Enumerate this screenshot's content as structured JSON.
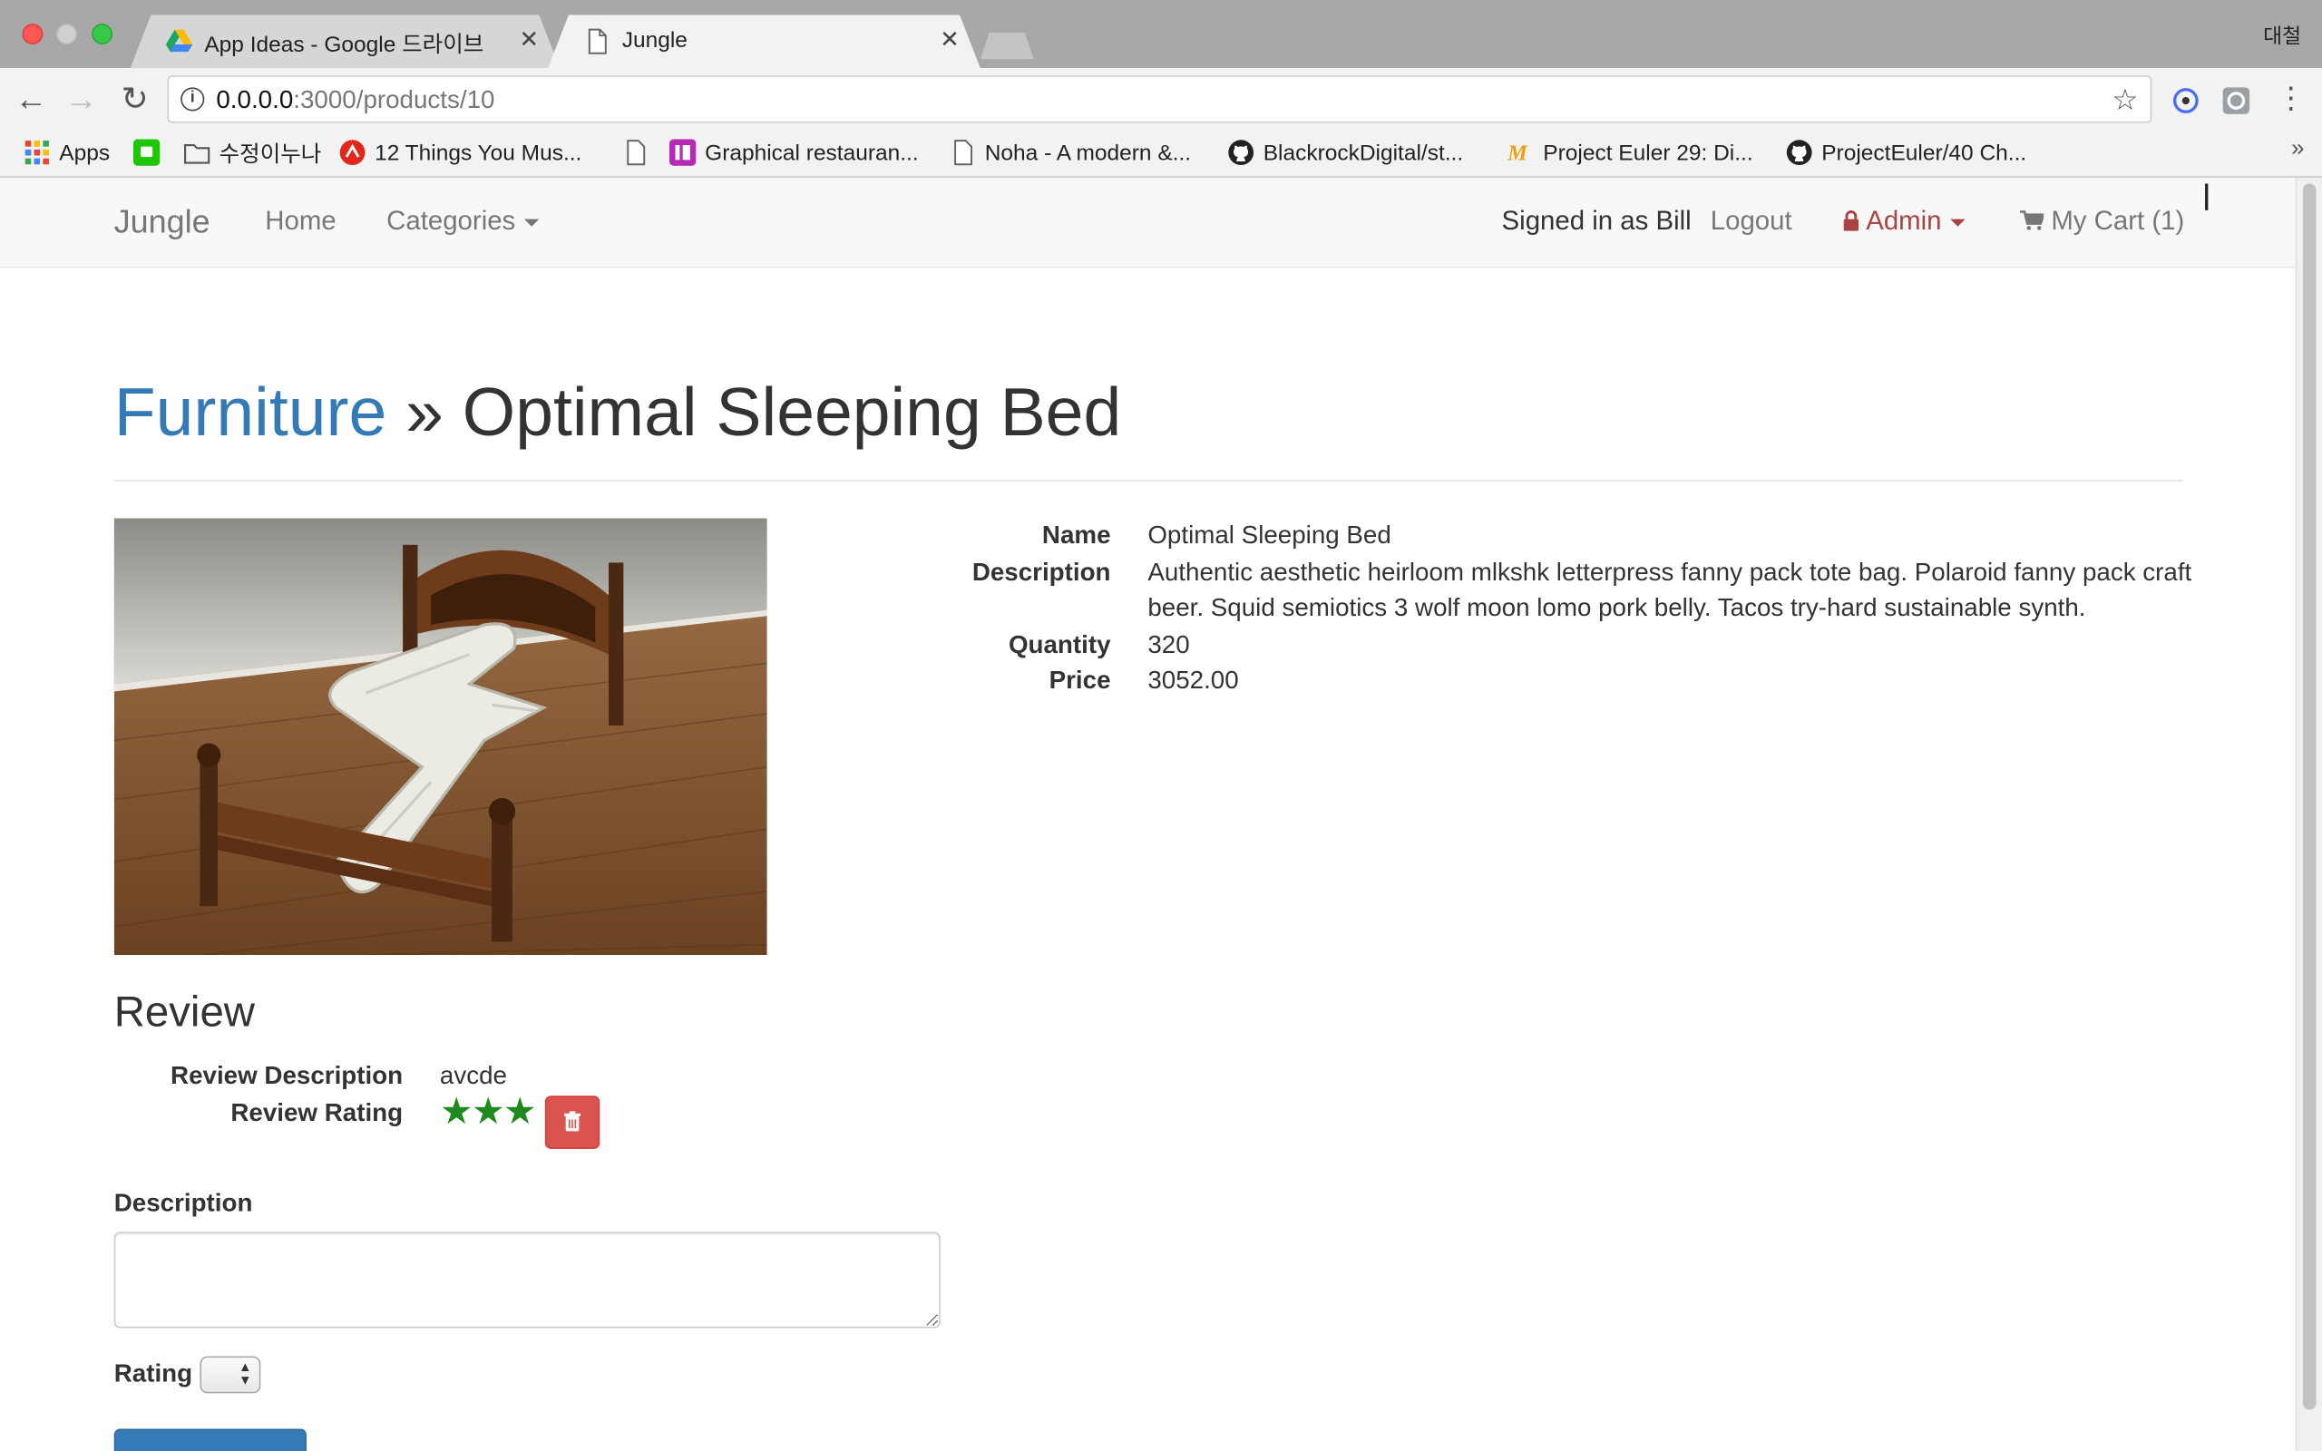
{
  "browser": {
    "tabs": [
      {
        "title": "App Ideas - Google 드라이브",
        "icon": "google-drive-icon",
        "active": false
      },
      {
        "title": "Jungle",
        "icon": "document-icon",
        "active": true
      }
    ],
    "profile_name": "대철",
    "url_host": "0.0.0.0",
    "url_rest": ":3000/products/10",
    "bookmarks": [
      {
        "label": "Apps",
        "icon": "apps-grid-icon"
      },
      {
        "label": "",
        "icon": "green-app-icon"
      },
      {
        "label": "수정이누나",
        "icon": "folder-icon"
      },
      {
        "label": "12 Things You Mus...",
        "icon": "red-site-icon"
      },
      {
        "label": "",
        "icon": "document-icon"
      },
      {
        "label": "Graphical restauran...",
        "icon": "purple-site-icon"
      },
      {
        "label": "Noha - A modern &...",
        "icon": "document-icon"
      },
      {
        "label": "BlackrockDigital/st...",
        "icon": "github-icon"
      },
      {
        "label": "Project Euler 29: Di...",
        "icon": "orange-m-icon"
      },
      {
        "label": "ProjectEuler/40 Ch...",
        "icon": "github-icon"
      }
    ]
  },
  "navbar": {
    "brand": "Jungle",
    "home": "Home",
    "categories": "Categories",
    "signed_in": "Signed in as Bill",
    "logout": "Logout",
    "admin": "Admin",
    "cart": "My Cart (1)"
  },
  "product": {
    "category": "Furniture",
    "separator": "»",
    "name": "Optimal Sleeping Bed",
    "fields": {
      "name_label": "Name",
      "name_value": "Optimal Sleeping Bed",
      "description_label": "Description",
      "description_value": "Authentic aesthetic heirloom mlkshk letterpress fanny pack tote bag. Polaroid fanny pack craft beer. Squid semiotics 3 wolf moon lomo pork belly. Tacos try-hard sustainable synth.",
      "quantity_label": "Quantity",
      "quantity_value": "320",
      "price_label": "Price",
      "price_value": "3052.00"
    }
  },
  "review": {
    "heading": "Review",
    "description_label": "Review Description",
    "description_value": "avcde",
    "rating_label": "Review Rating",
    "rating_value": 3,
    "stars": "★★★"
  },
  "form": {
    "description_label": "Description",
    "rating_label": "Rating"
  },
  "colors": {
    "link": "#337ab7",
    "admin": "#a94442",
    "danger": "#d9534f",
    "stars": "#1e8a1e"
  }
}
